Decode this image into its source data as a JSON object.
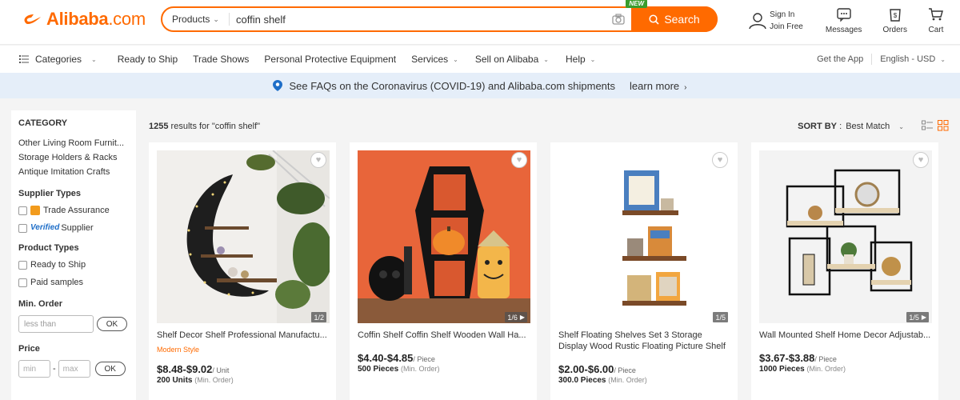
{
  "header": {
    "logo_text": "Alibaba",
    "logo_suffix": ".com",
    "search_category": "Products",
    "search_value": "coffin shelf",
    "new_badge": "NEW",
    "search_button": "Search",
    "sign_in": "Sign In",
    "join_free": "Join Free",
    "messages": "Messages",
    "orders": "Orders",
    "cart": "Cart"
  },
  "nav": {
    "categories": "Categories",
    "links": [
      "Ready to Ship",
      "Trade Shows",
      "Personal Protective Equipment",
      "Services",
      "Sell on Alibaba",
      "Help"
    ],
    "get_app": "Get the App",
    "language": "English - USD"
  },
  "banner": {
    "text": "See FAQs on the Coronavirus (COVID-19) and Alibaba.com shipments",
    "link": "learn more"
  },
  "sidebar": {
    "category_title": "CATEGORY",
    "categories": [
      "Other Living Room Furnit...",
      "Storage Holders & Racks",
      "Antique Imitation Crafts"
    ],
    "supplier_types_title": "Supplier Types",
    "trade_assurance": "Trade Assurance",
    "verified_label": "Verified",
    "supplier": "Supplier",
    "product_types_title": "Product Types",
    "ready_to_ship": "Ready to Ship",
    "paid_samples": "Paid samples",
    "min_order_title": "Min. Order",
    "less_than_placeholder": "less than",
    "ok": "OK",
    "price_title": "Price",
    "min_placeholder": "min",
    "max_placeholder": "max",
    "ok2": "OK"
  },
  "results": {
    "count": "1255",
    "suffix": " results for \"coffin shelf\"",
    "sort_label": "SORT BY",
    "sort_value": "Best Match"
  },
  "products": [
    {
      "title": "Shelf Decor Shelf Professional Manufactu...",
      "tag": "Modern Style",
      "price": "$8.48-$9.02",
      "price_unit": "/ Unit",
      "moq": "200 Units",
      "moq_unit": "(Min. Order)",
      "counter": "1/2"
    },
    {
      "title": "Coffin Shelf Coffin Shelf Wooden Wall Ha...",
      "tag": "",
      "price": "$4.40-$4.85",
      "price_unit": "/ Piece",
      "moq": "500 Pieces",
      "moq_unit": "(Min. Order)",
      "counter": "1/6"
    },
    {
      "title": "Shelf Floating Shelves Set 3 Storage",
      "title2": "Display Wood Rustic Floating Picture Shelf",
      "tag": "",
      "price": "$2.00-$6.00",
      "price_unit": "/ Piece",
      "moq": "300.0 Pieces",
      "moq_unit": "(Min. Order)",
      "counter": "1/5"
    },
    {
      "title": "Wall Mounted Shelf Home Decor Adjustab...",
      "tag": "",
      "price": "$3.67-$3.88",
      "price_unit": "/ Piece",
      "moq": "1000 Pieces",
      "moq_unit": "(Min. Order)",
      "counter": "1/5"
    }
  ],
  "colors": {
    "accent": "#ff6a00",
    "banner": "#e5eef9",
    "verified": "#1e6ec8"
  }
}
